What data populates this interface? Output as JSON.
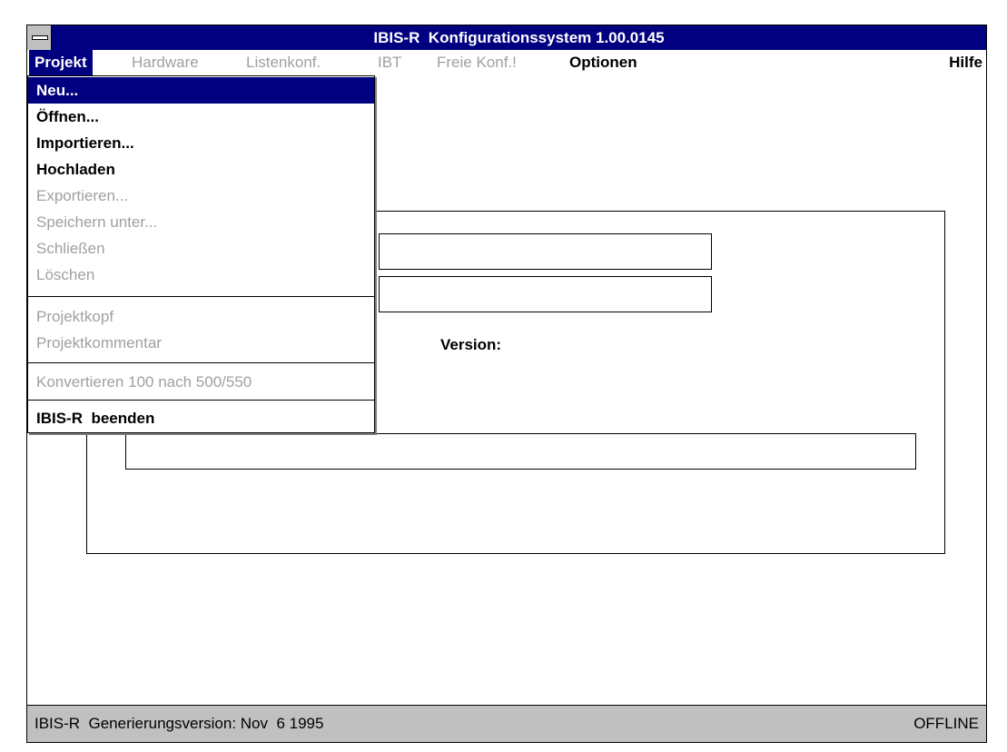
{
  "window": {
    "title": "IBIS-R  Konfigurationssystem 1.00.0145"
  },
  "menubar": {
    "projekt": "Projekt",
    "hardware": "Hardware",
    "listenkonf": "Listenkonf.",
    "ibt": "IBT",
    "freie_konf": "Freie Konf.!",
    "optionen": "Optionen",
    "hilfe": "Hilfe"
  },
  "projekt_menu": {
    "items": [
      {
        "label": "Neu...",
        "enabled": true,
        "highlighted": true
      },
      {
        "label": "Öffnen...",
        "enabled": true
      },
      {
        "label": "Importieren...",
        "enabled": true
      },
      {
        "label": "Hochladen",
        "enabled": true
      },
      {
        "label": "Exportieren...",
        "enabled": false
      },
      {
        "label": "Speichern unter...",
        "enabled": false
      },
      {
        "label": "Schließen",
        "enabled": false
      },
      {
        "label": "Löschen",
        "enabled": false
      },
      {
        "label": "Projektkopf",
        "enabled": false
      },
      {
        "label": "Projektkommentar",
        "enabled": false
      },
      {
        "label": "Konvertieren 100 nach 500/550",
        "enabled": false
      },
      {
        "label": "IBIS-R  beenden",
        "enabled": true
      }
    ]
  },
  "main": {
    "version_label": "Version:"
  },
  "status": {
    "left": "IBIS-R  Generierungsversion: Nov  6 1995",
    "right": "OFFLINE"
  }
}
